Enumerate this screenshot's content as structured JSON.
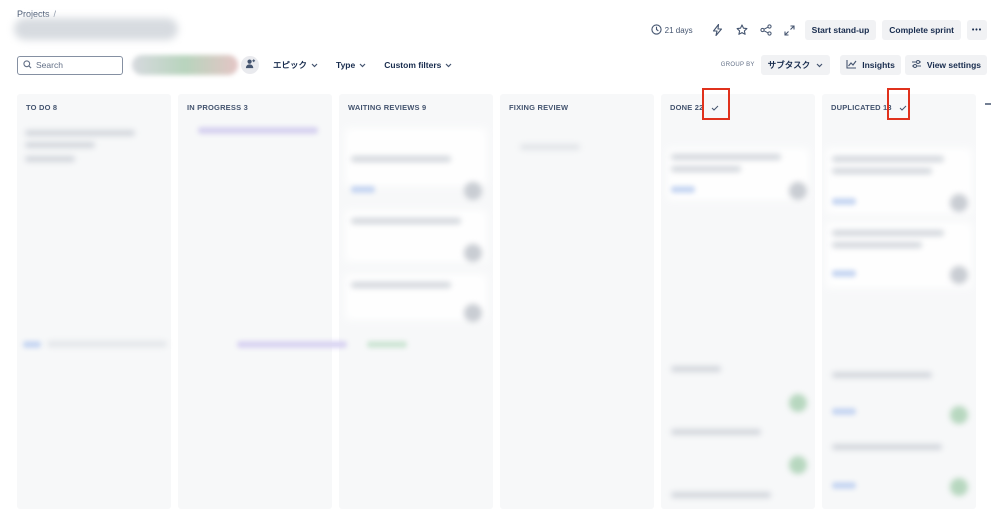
{
  "breadcrumb": {
    "root": "Projects",
    "separator": "/"
  },
  "header": {
    "days": "21 days",
    "start_standup": "Start stand-up",
    "complete_sprint": "Complete sprint",
    "more": "•••"
  },
  "toolbar": {
    "search_placeholder": "Search",
    "epic_filter": "エピック",
    "type_filter": "Type",
    "custom_filters": "Custom filters",
    "group_by_label": "GROUP BY",
    "group_by_value": "サブタスク",
    "insights": "Insights",
    "view_settings": "View settings"
  },
  "columns": [
    {
      "label": "TO DO 8",
      "done": false
    },
    {
      "label": "IN PROGRESS 3",
      "done": false
    },
    {
      "label": "WAITING REVIEWS 9",
      "done": false
    },
    {
      "label": "FIXING REVIEW",
      "done": false
    },
    {
      "label": "DONE 22",
      "done": true
    },
    {
      "label": "DUPLICATED 13",
      "done": true
    }
  ],
  "colors": {
    "highlight": "#e0311c",
    "column_bg": "#f7f8f9",
    "button_bg": "#f1f2f4"
  }
}
